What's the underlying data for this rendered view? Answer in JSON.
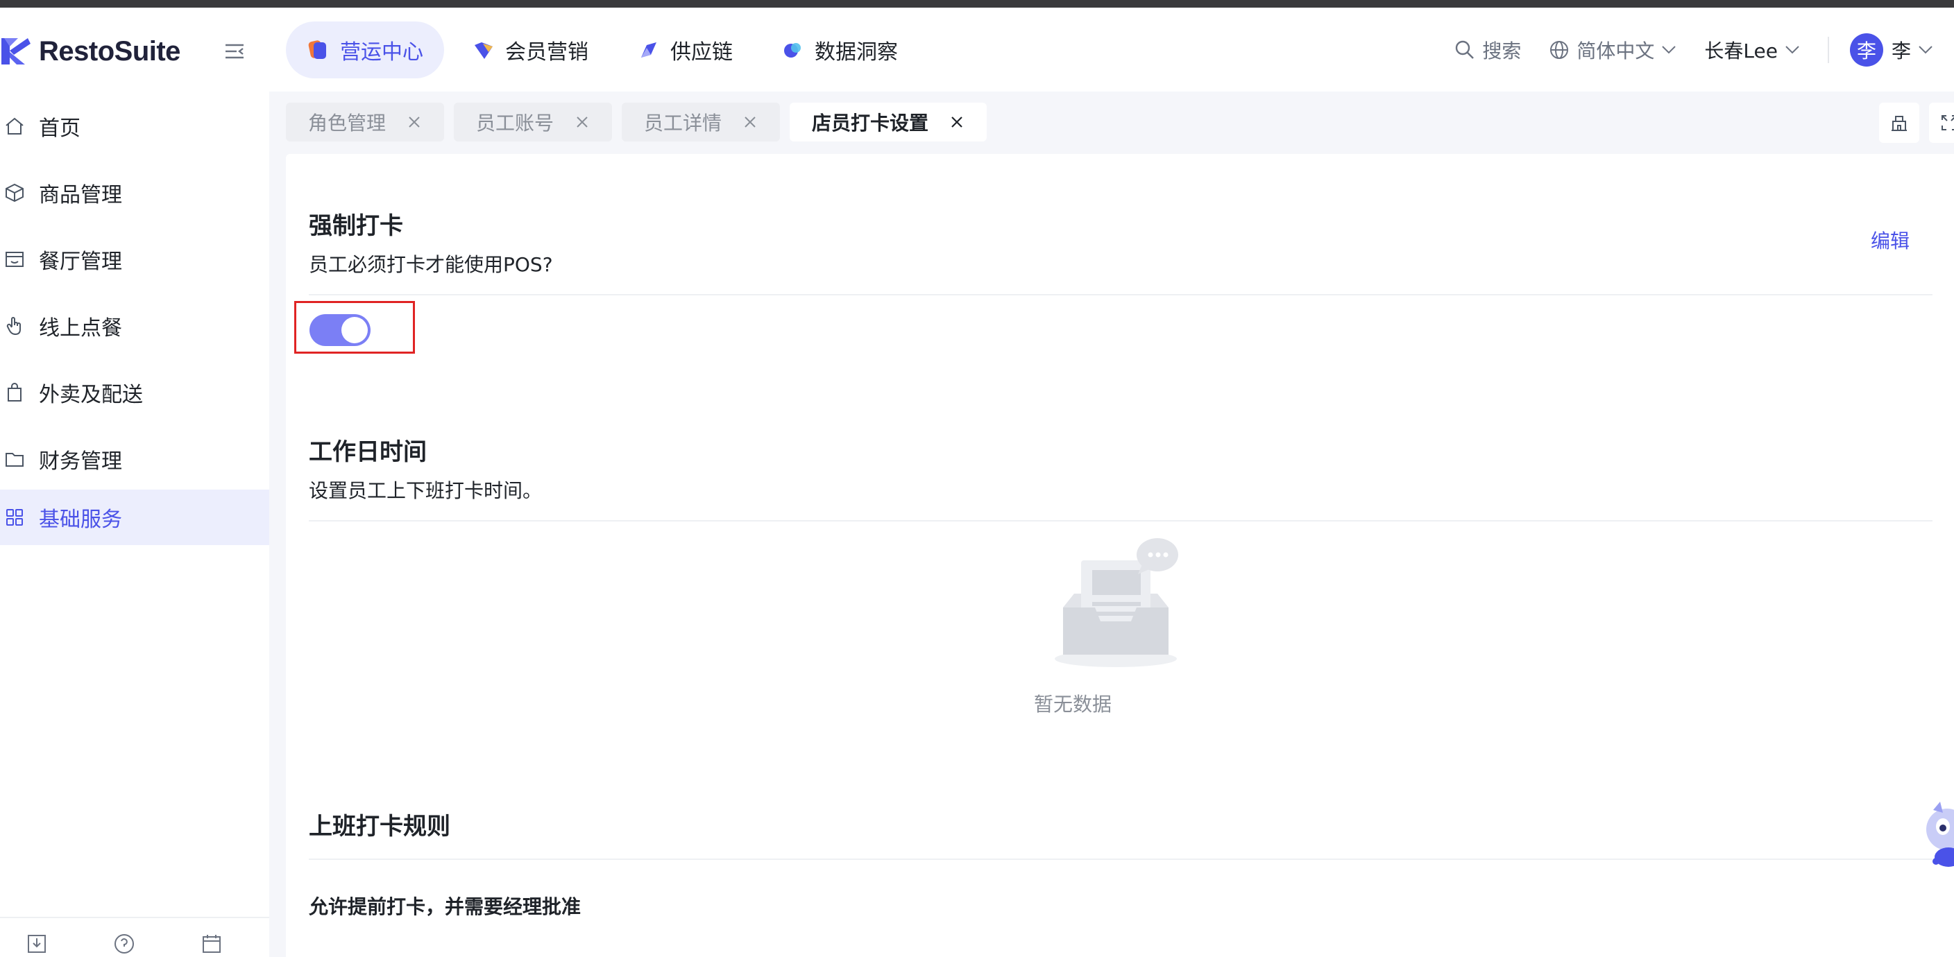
{
  "brand": {
    "name": "RestoSuite"
  },
  "top_nav": [
    {
      "label": "营运中心",
      "active": true
    },
    {
      "label": "会员营销",
      "active": false
    },
    {
      "label": "供应链",
      "active": false
    },
    {
      "label": "数据洞察",
      "active": false
    }
  ],
  "header_right": {
    "search_label": "搜索",
    "language": "简体中文",
    "user_name": "长春Lee",
    "avatar_initial": "李",
    "avatar_name": "李"
  },
  "sidebar": {
    "items": [
      {
        "label": "首页",
        "icon": "home-icon"
      },
      {
        "label": "商品管理",
        "icon": "box-icon"
      },
      {
        "label": "餐厅管理",
        "icon": "store-icon"
      },
      {
        "label": "线上点餐",
        "icon": "hand-pointer-icon"
      },
      {
        "label": "外卖及配送",
        "icon": "bag-icon"
      },
      {
        "label": "财务管理",
        "icon": "folder-icon"
      },
      {
        "label": "基础服务",
        "icon": "grid-icon",
        "active": true
      }
    ]
  },
  "tabs": [
    {
      "label": "角色管理",
      "active": false
    },
    {
      "label": "员工账号",
      "active": false
    },
    {
      "label": "员工详情",
      "active": false
    },
    {
      "label": "店员打卡设置",
      "active": true
    }
  ],
  "content": {
    "forced_clock_in": {
      "title": "强制打卡",
      "description": "员工必须打卡才能使用POS?",
      "edit_label": "编辑",
      "toggle_on": true
    },
    "workday_time": {
      "title": "工作日时间",
      "description": "设置员工上下班打卡时间。",
      "empty_text": "暂无数据"
    },
    "clock_in_rules": {
      "title": "上班打卡规则",
      "rule_1": "允许提前打卡，并需要经理批准"
    }
  },
  "colors": {
    "accent": "#4a52e8",
    "toggle_on": "#7b7ff5",
    "highlight": "#e02424"
  }
}
